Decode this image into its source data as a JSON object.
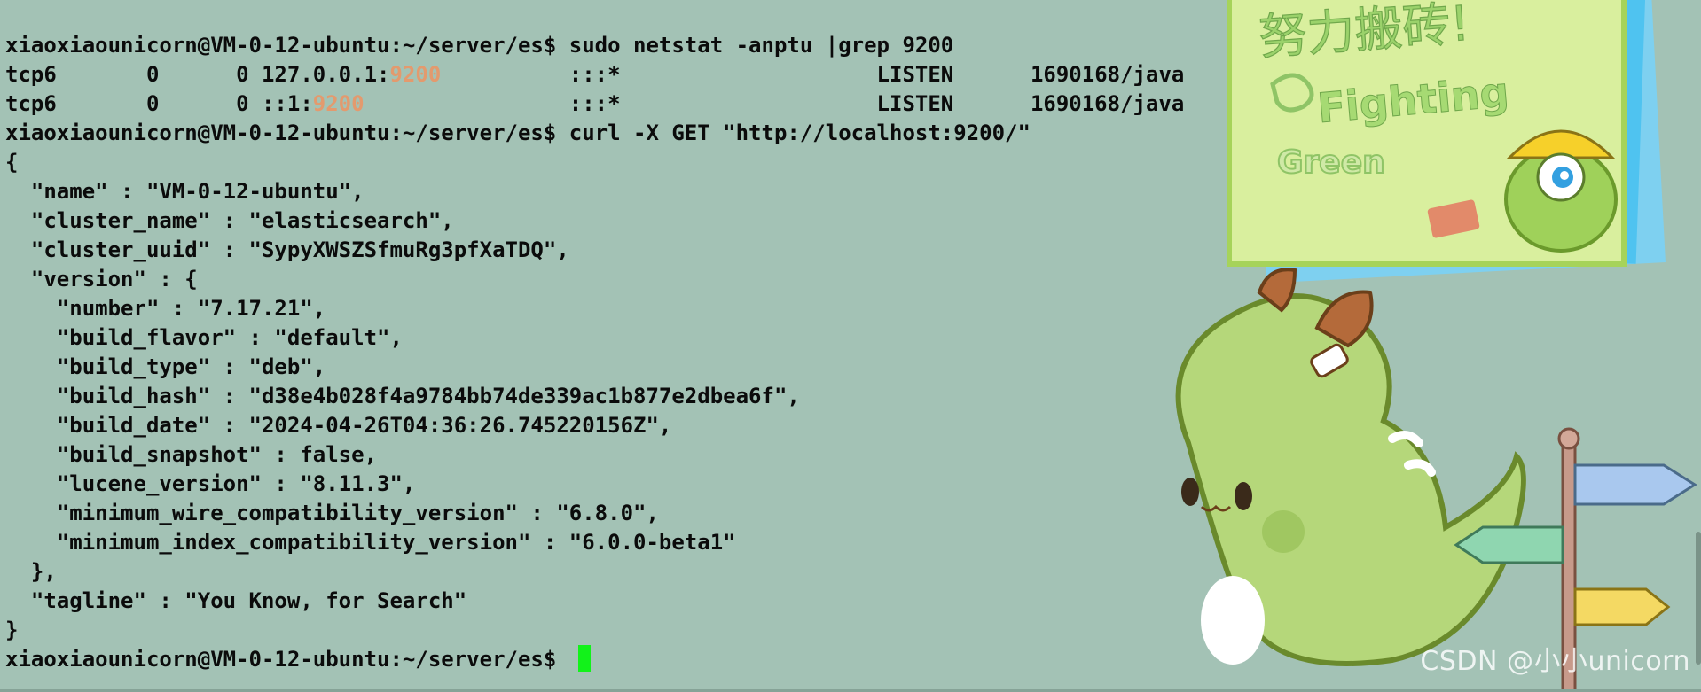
{
  "terminal": {
    "lines": [
      "xiaoxiaounicorn@VM-0-12-ubuntu:~/server/es$ sudo netstat -anptu |grep 9200",
      "tcp6       0      0 127.0.0.1:9200          :::*                    LISTEN      1690168/java",
      "tcp6       0      0 ::1:9200                :::*                    LISTEN      1690168/java",
      "xiaoxiaounicorn@VM-0-12-ubuntu:~/server/es$ curl -X GET \"http://localhost:9200/\"",
      "{",
      "  \"name\" : \"VM-0-12-ubuntu\",",
      "  \"cluster_name\" : \"elasticsearch\",",
      "  \"cluster_uuid\" : \"SypyXWSZSfmuRg3pfXaTDQ\",",
      "  \"version\" : {",
      "    \"number\" : \"7.17.21\",",
      "    \"build_flavor\" : \"default\",",
      "    \"build_type\" : \"deb\",",
      "    \"build_hash\" : \"d38e4b028f4a9784bb74de339ac1b877e2dbea6f\",",
      "    \"build_date\" : \"2024-04-26T04:36:26.745220156Z\",",
      "    \"build_snapshot\" : false,",
      "    \"lucene_version\" : \"8.11.3\",",
      "    \"minimum_wire_compatibility_version\" : \"6.8.0\",",
      "    \"minimum_index_compatibility_version\" : \"6.0.0-beta1\"",
      "  },",
      "  \"tagline\" : \"You Know, for Search\"",
      "}",
      "xiaoxiaounicorn@VM-0-12-ubuntu:~/server/es$ "
    ],
    "highlight_port": "9200",
    "colors": {
      "background": "#a3c2b5",
      "text": "#0b0b0b",
      "port_highlight": "#e39a6e",
      "cursor": "#12f21a"
    }
  },
  "wallpaper": {
    "note_title": "努力搬砖!",
    "note_subtitle": "Fighting",
    "note_tag": "Green",
    "illustration": "green-dinosaur-with-signpost"
  },
  "watermark": {
    "text": "CSDN @小小unicorn"
  }
}
